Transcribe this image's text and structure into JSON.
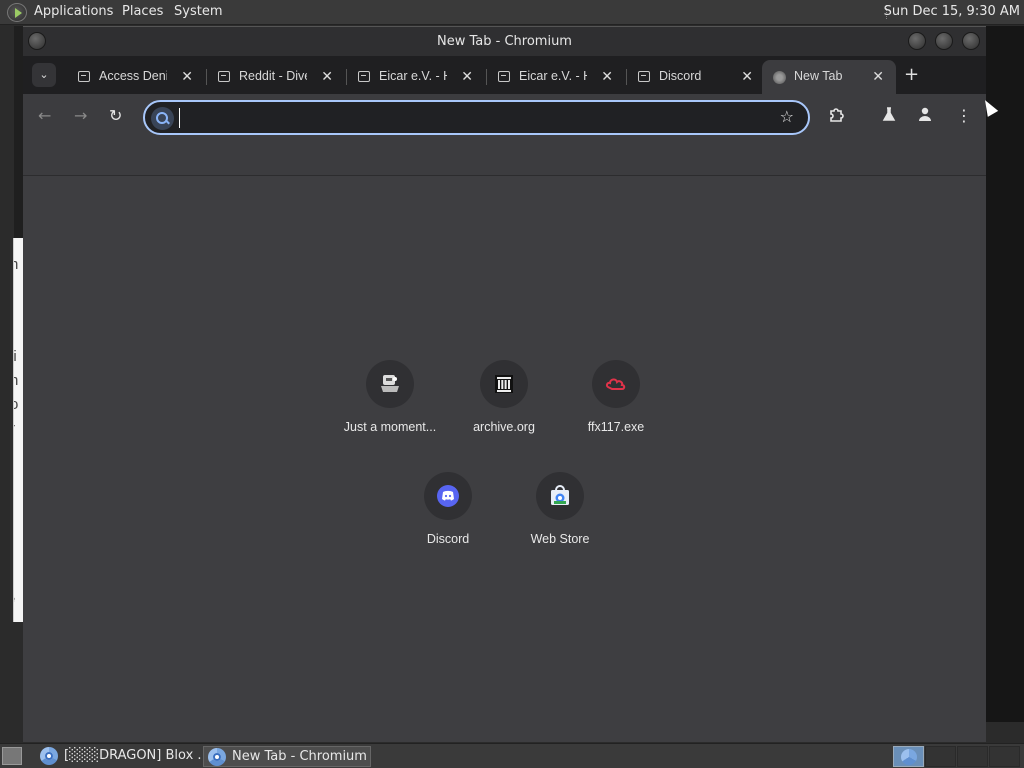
{
  "top_panel": {
    "menus": [
      "Applications",
      "Places",
      "System"
    ],
    "clock": "Sun Dec 15,  9:30 AM"
  },
  "background_window": {
    "text_fragments": [
      "h",
      "li",
      "n",
      "o",
      "r",
      "e"
    ]
  },
  "window": {
    "title": "New Tab - Chromium"
  },
  "tabs": [
    {
      "title": "Access Denied",
      "favicon": "sad-folder-icon",
      "active": false
    },
    {
      "title": "Reddit - Dive into anything",
      "favicon": "sad-folder-icon",
      "active": false
    },
    {
      "title": "Eicar e.V. - Home",
      "favicon": "sad-folder-icon",
      "active": false
    },
    {
      "title": "Eicar e.V. - Home",
      "favicon": "sad-folder-icon",
      "active": false
    },
    {
      "title": "Discord",
      "favicon": "sad-folder-icon",
      "active": false
    },
    {
      "title": "New Tab",
      "favicon": "globe-icon",
      "active": true
    }
  ],
  "omnibox": {
    "value": "",
    "placeholder": ""
  },
  "shortcuts": [
    {
      "label": "Just a moment...",
      "icon": "cloudflare-robot-icon"
    },
    {
      "label": "archive.org",
      "icon": "archive-building-icon"
    },
    {
      "label": "ffx117.exe",
      "icon": "red-cloud-icon"
    },
    {
      "label": "Discord",
      "icon": "discord-icon"
    },
    {
      "label": "Web Store",
      "icon": "web-store-icon"
    }
  ],
  "taskbar": {
    "tasks": [
      {
        "label": "[░░░DRAGON] Blox ...",
        "active": false
      },
      {
        "label": "New Tab - Chromium",
        "active": true
      }
    ]
  },
  "colors": {
    "accent_focus_ring": "#a8c7fa",
    "ntp_background": "#3e3e41",
    "toolbar": "#3c3c3f",
    "tabstrip": "#1f1f21",
    "discord": "#5865f2",
    "ffx_red": "#e0334a"
  }
}
